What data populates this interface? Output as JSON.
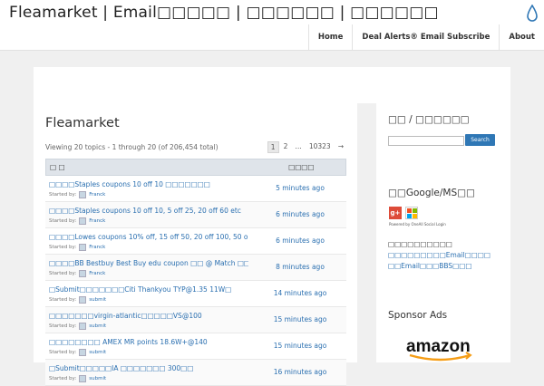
{
  "header": {
    "site_title": "Fleamarket | Email□□□□□ | □□□□□□ | □□□□□□",
    "nav": [
      "Home",
      "Deal Alerts® Email Subscribe",
      "About"
    ]
  },
  "main": {
    "forum_title": "Fleamarket",
    "viewing_text": "Viewing 20 topics - 1 through 20 (of 206,454 total)",
    "pagination": [
      "1",
      "2",
      "…",
      "10323",
      "→"
    ],
    "table_headers": {
      "topic": "□ □",
      "freshness": "□□□□"
    },
    "started_by_label": "Started by:",
    "topics": [
      {
        "title": "□□□□Staples coupons 10 off 10 □□□□□□□",
        "author": "Franck",
        "freshness": "5 minutes ago"
      },
      {
        "title": "□□□□Staples coupons 10 off 10, 5 off 25, 20 off 60 etc",
        "author": "Franck",
        "freshness": "6 minutes ago"
      },
      {
        "title": "□□□□Lowes coupons 10% off, 15 off 50, 20 off 100, 50 o",
        "author": "Franck",
        "freshness": "6 minutes ago"
      },
      {
        "title": "□□□□BB Bestbuy Best Buy edu coupon □□ @ Match □□",
        "author": "Franck",
        "freshness": "8 minutes ago"
      },
      {
        "title": "□Submit□□□□□□□Citi Thankyou TYP@1.35 11W□",
        "author": "submit",
        "freshness": "14 minutes ago"
      },
      {
        "title": "□□□□□□□virgin-atlantic□□□□□VS@100",
        "author": "submit",
        "freshness": "15 minutes ago"
      },
      {
        "title": "□□□□□□□□ AMEX MR points 18.6W+@140",
        "author": "submit",
        "freshness": "15 minutes ago"
      },
      {
        "title": "□Submit□□□□□IA □□□□□□□ 300□□",
        "author": "submit",
        "freshness": "16 minutes ago"
      }
    ]
  },
  "sidebar": {
    "search_title": "□□ / □□□□□□",
    "search_button": "Search",
    "login_title": "□□Google/MS□□",
    "powered_text": "Powered by OneAll Social Login",
    "links": [
      "□□□□□□□□□□",
      "□□□□□□□□□Email□□□□",
      "□□Email□□□BBS□□□"
    ],
    "sponsor_title": "Sponsor Ads",
    "amazon_text": "amazon"
  },
  "colors": {
    "link": "#2a6fb0",
    "button": "#2f77b5",
    "google_plus": "#dd4b39"
  }
}
